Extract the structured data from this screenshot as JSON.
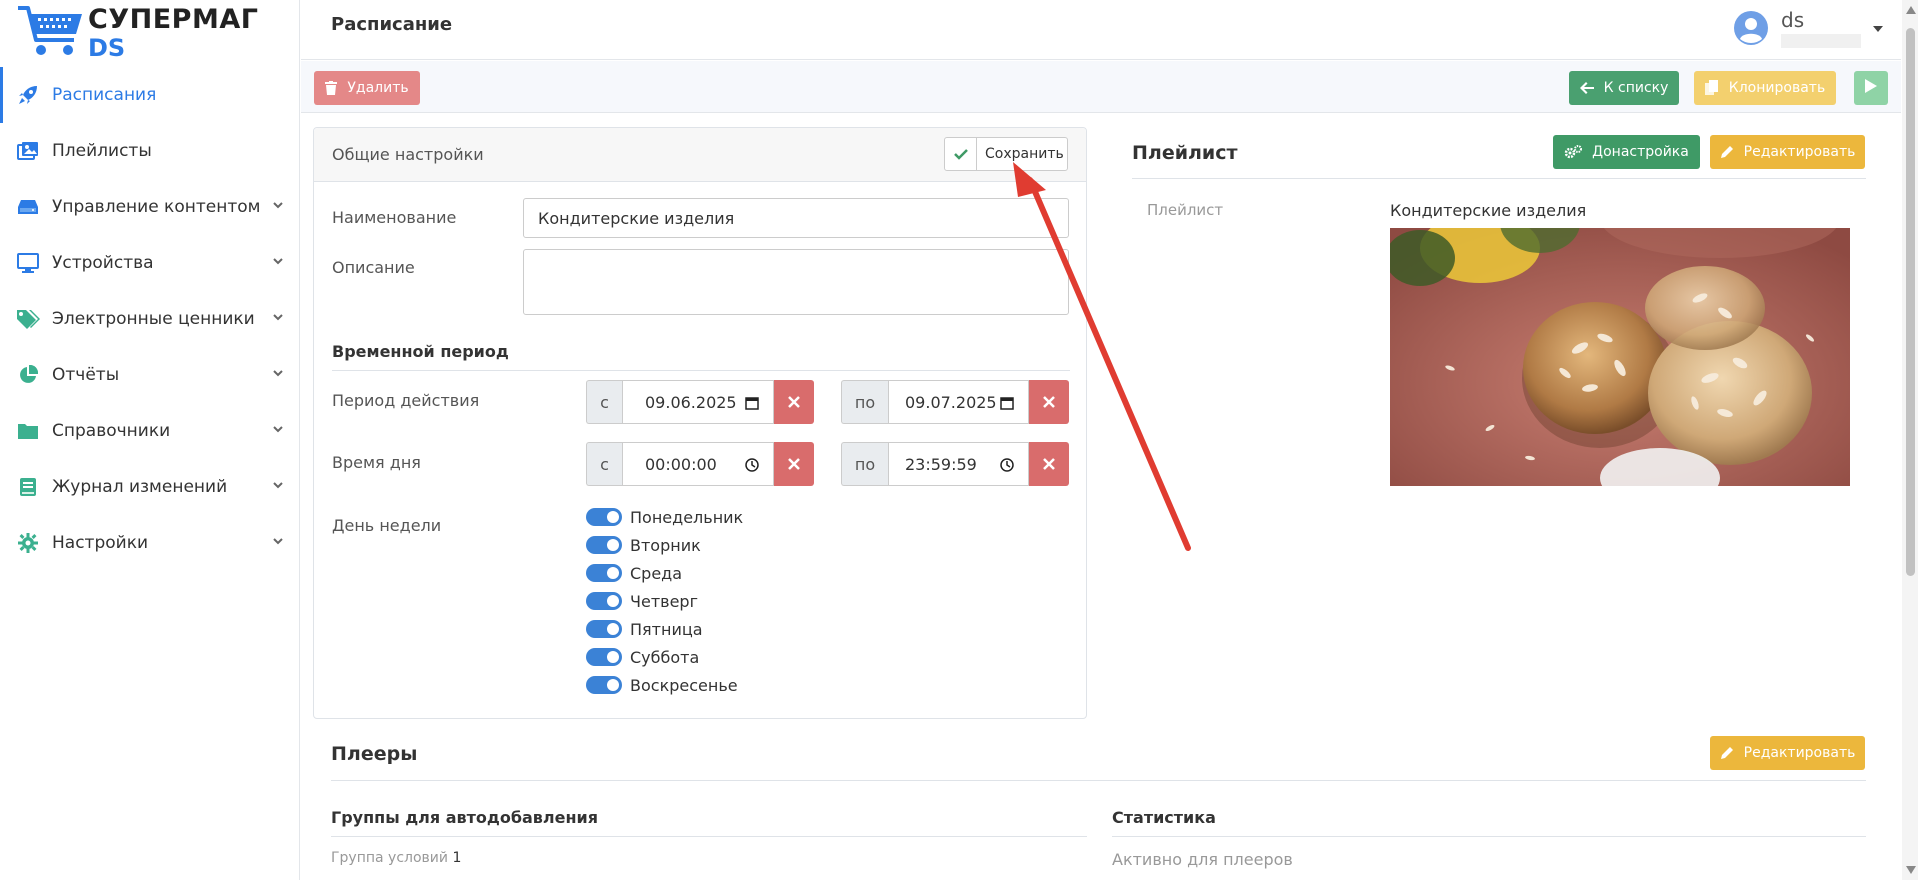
{
  "brand": {
    "line1": "СУПЕРМАГ",
    "line2": "DS"
  },
  "sidebar": {
    "items": [
      {
        "label": "Расписания",
        "icon": "rocket-icon"
      },
      {
        "label": "Плейлисты",
        "icon": "images-icon"
      },
      {
        "label": "Управление контентом",
        "icon": "hdd-icon"
      },
      {
        "label": "Устройства",
        "icon": "monitor-icon"
      },
      {
        "label": "Электронные ценники",
        "icon": "tags-icon"
      },
      {
        "label": "Отчёты",
        "icon": "pie-chart-icon"
      },
      {
        "label": "Справочники",
        "icon": "folder-icon"
      },
      {
        "label": "Журнал изменений",
        "icon": "book-icon"
      },
      {
        "label": "Настройки",
        "icon": "gear-icon"
      }
    ]
  },
  "header": {
    "title": "Расписание",
    "user": "ds"
  },
  "toolbar": {
    "delete": "Удалить",
    "to_list": "К списку",
    "clone": "Клонировать"
  },
  "general": {
    "title": "Общие настройки",
    "save": "Сохранить",
    "name_label": "Наименование",
    "name_value": "Кондитерские изделия",
    "desc_label": "Описание",
    "desc_value": "",
    "period_section": "Временной период",
    "validity_label": "Период действия",
    "from_prefix": "с",
    "to_prefix": "по",
    "date_from": "09.06.2025",
    "date_to": "09.07.2025",
    "time_label": "Время дня",
    "time_from": "00:00:00",
    "time_to": "23:59:59",
    "weekday_label": "День недели",
    "weekdays": [
      "Понедельник",
      "Вторник",
      "Среда",
      "Четверг",
      "Пятница",
      "Суббота",
      "Воскресенье"
    ]
  },
  "playlist": {
    "title": "Плейлист",
    "tune": "Донастройка",
    "edit": "Редактировать",
    "key": "Плейлист",
    "value": "Кондитерские изделия"
  },
  "players": {
    "title": "Плееры",
    "edit": "Редактировать",
    "groups_title": "Группы для автодобавления",
    "groups_key": "Группа условий",
    "groups_count": "1",
    "stats_title": "Статистика",
    "stats_key": "Активно для плееров"
  },
  "colors": {
    "accent": "#2c7be5",
    "danger": "#d96c6c",
    "success": "#4aa070",
    "warning": "#ecb73c"
  }
}
